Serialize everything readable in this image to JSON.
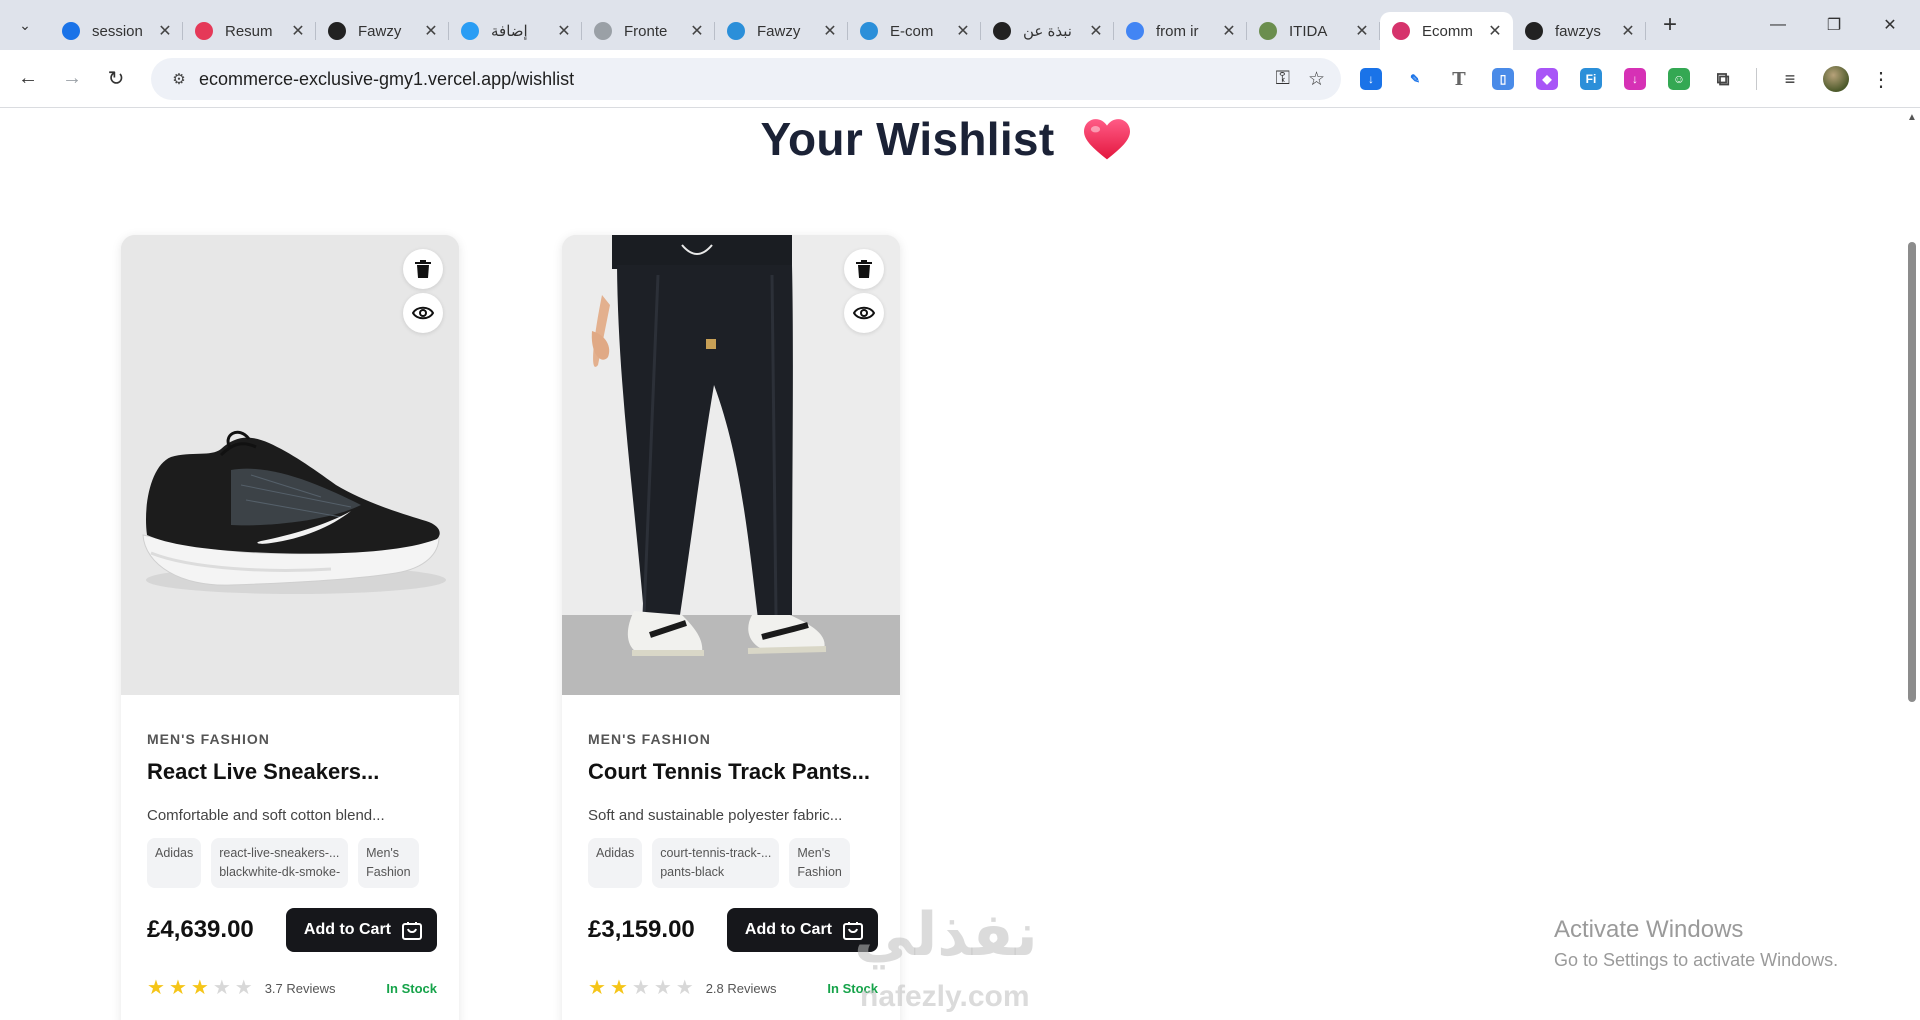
{
  "browser": {
    "tabs": [
      {
        "title": "session",
        "favicon": "google-drive",
        "color": "#1a73e8",
        "active": false
      },
      {
        "title": "Resum",
        "favicon": "resume-app",
        "color": "#e53958",
        "active": false
      },
      {
        "title": "Fawzy",
        "favicon": "upwork",
        "color": "#222222",
        "active": false
      },
      {
        "title": "إضافة",
        "favicon": "circle-app",
        "color": "#2a9df4",
        "active": false
      },
      {
        "title": "Fronte",
        "favicon": "frontend-doc",
        "color": "#9aa0a6",
        "active": false
      },
      {
        "title": "Fawzy",
        "favicon": "bird-app",
        "color": "#2b8fd9",
        "active": false
      },
      {
        "title": "E-com",
        "favicon": "bird-app",
        "color": "#2b8fd9",
        "active": false
      },
      {
        "title": "نبذة عن",
        "favicon": "openai",
        "color": "#222222",
        "active": false
      },
      {
        "title": "from ir",
        "favicon": "google",
        "color": "#4285f4",
        "active": false
      },
      {
        "title": "ITIDA",
        "favicon": "itida",
        "color": "#6b8e4e",
        "active": false
      },
      {
        "title": "Ecomm",
        "favicon": "angular",
        "color": "#d6336c",
        "active": true
      },
      {
        "title": "fawzys",
        "favicon": "github",
        "color": "#222222",
        "active": false
      }
    ],
    "url": "ecommerce-exclusive-gmy1.vercel.app/wishlist"
  },
  "page": {
    "title": "Your Wishlist",
    "heart_color": "#ef2d56"
  },
  "products": [
    {
      "category": "MEN'S FASHION",
      "name": "React Live Sneakers...",
      "description": "Comfortable and soft cotton blend...",
      "tags": [
        {
          "line1": "Adidas",
          "line2": ""
        },
        {
          "line1": "react-live-sneakers-...",
          "line2": "blackwhite-dk-smoke-"
        },
        {
          "line1": "Men's",
          "line2": "Fashion"
        }
      ],
      "price": "£4,639.00",
      "cart_label": "Add to Cart",
      "rating": 3,
      "reviews": "3.7 Reviews",
      "stock": "In Stock"
    },
    {
      "category": "MEN'S FASHION",
      "name": "Court Tennis Track Pants...",
      "description": "Soft and sustainable polyester fabric...",
      "tags": [
        {
          "line1": "Adidas",
          "line2": ""
        },
        {
          "line1": "court-tennis-track-...",
          "line2": "pants-black"
        },
        {
          "line1": "Men's",
          "line2": "Fashion"
        }
      ],
      "price": "£3,159.00",
      "cart_label": "Add to Cart",
      "rating": 2,
      "reviews": "2.8 Reviews",
      "stock": "In Stock"
    }
  ],
  "overlay": {
    "watermark_ar": "نفذلي",
    "watermark_en": "nafezly.com",
    "activate_title": "Activate Windows",
    "activate_sub": "Go to Settings to activate Windows."
  }
}
